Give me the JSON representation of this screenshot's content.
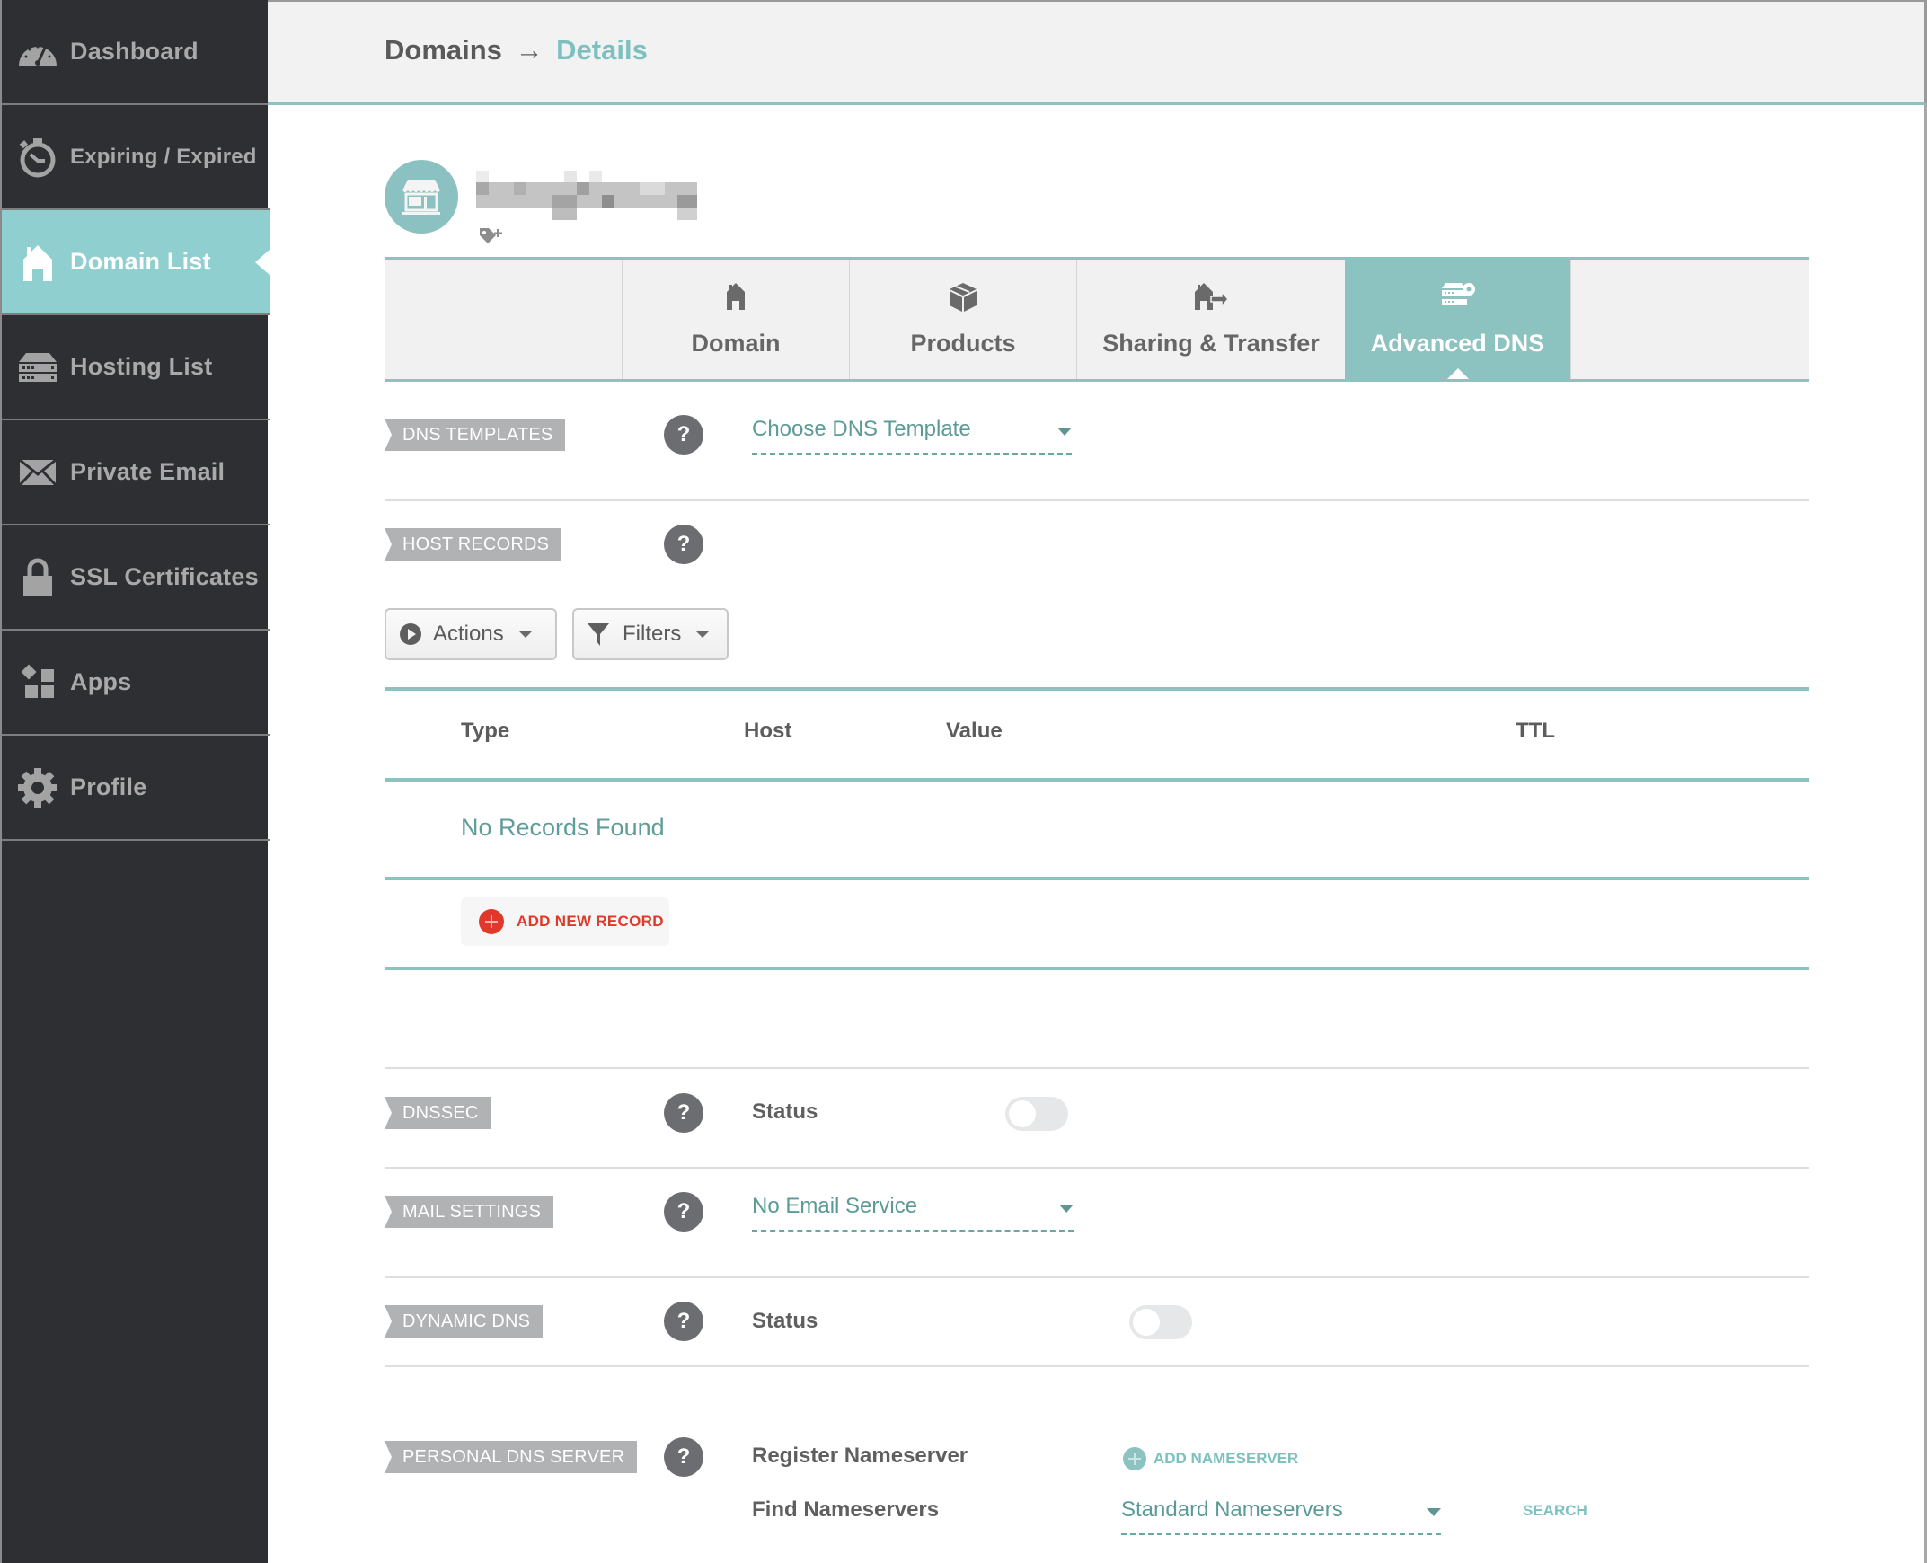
{
  "sidebar": {
    "items": [
      {
        "label": "Dashboard",
        "icon": "dashboard-gauge-icon",
        "active": false
      },
      {
        "label": "Expiring / Expired",
        "icon": "stopwatch-icon",
        "active": false
      },
      {
        "label": "Domain List",
        "icon": "house-icon",
        "active": true
      },
      {
        "label": "Hosting List",
        "icon": "server-icon",
        "active": false
      },
      {
        "label": "Private Email",
        "icon": "envelope-icon",
        "active": false
      },
      {
        "label": "SSL Certificates",
        "icon": "lock-icon",
        "active": false
      },
      {
        "label": "Apps",
        "icon": "apps-grid-icon",
        "active": false
      },
      {
        "label": "Profile",
        "icon": "gear-icon",
        "active": false
      }
    ]
  },
  "header": {
    "breadcrumb": {
      "parent": "Domains",
      "separator": "→",
      "current": "Details"
    }
  },
  "domain": {
    "name_redacted": true,
    "icon": "storefront-icon",
    "tag_icon": "add-tag-icon"
  },
  "tabs": [
    {
      "label": "Domain",
      "icon": "house-icon",
      "active": false
    },
    {
      "label": "Products",
      "icon": "box-icon",
      "active": false
    },
    {
      "label": "Sharing & Transfer",
      "icon": "house-transfer-icon",
      "active": false
    },
    {
      "label": "Advanced DNS",
      "icon": "server-gear-icon",
      "active": true
    }
  ],
  "dns_templates": {
    "label": "DNS TEMPLATES",
    "help": "?",
    "dropdown_value": "Choose DNS Template"
  },
  "host_records": {
    "label": "HOST RECORDS",
    "help": "?",
    "actions_label": "Actions",
    "filters_label": "Filters",
    "columns": [
      "Type",
      "Host",
      "Value",
      "TTL"
    ],
    "rows": [],
    "empty_text": "No Records Found",
    "add_label": "ADD NEW RECORD"
  },
  "dnssec": {
    "label": "DNSSEC",
    "help": "?",
    "status_label": "Status",
    "enabled": false
  },
  "mail_settings": {
    "label": "MAIL SETTINGS",
    "help": "?",
    "dropdown_value": "No Email Service"
  },
  "dynamic_dns": {
    "label": "DYNAMIC DNS",
    "help": "?",
    "status_label": "Status",
    "enabled": false
  },
  "personal_dns": {
    "label": "PERSONAL DNS SERVER",
    "help": "?",
    "register_label": "Register Nameserver",
    "add_ns_label": "ADD NAMESERVER",
    "find_label": "Find Nameservers",
    "find_dropdown_value": "Standard Nameservers",
    "search_label": "SEARCH"
  },
  "colors": {
    "accent_teal": "#8cc2c0",
    "sidebar_bg": "#2e2f33",
    "active_nav": "#8fcfcf",
    "danger_red": "#e0392b"
  }
}
